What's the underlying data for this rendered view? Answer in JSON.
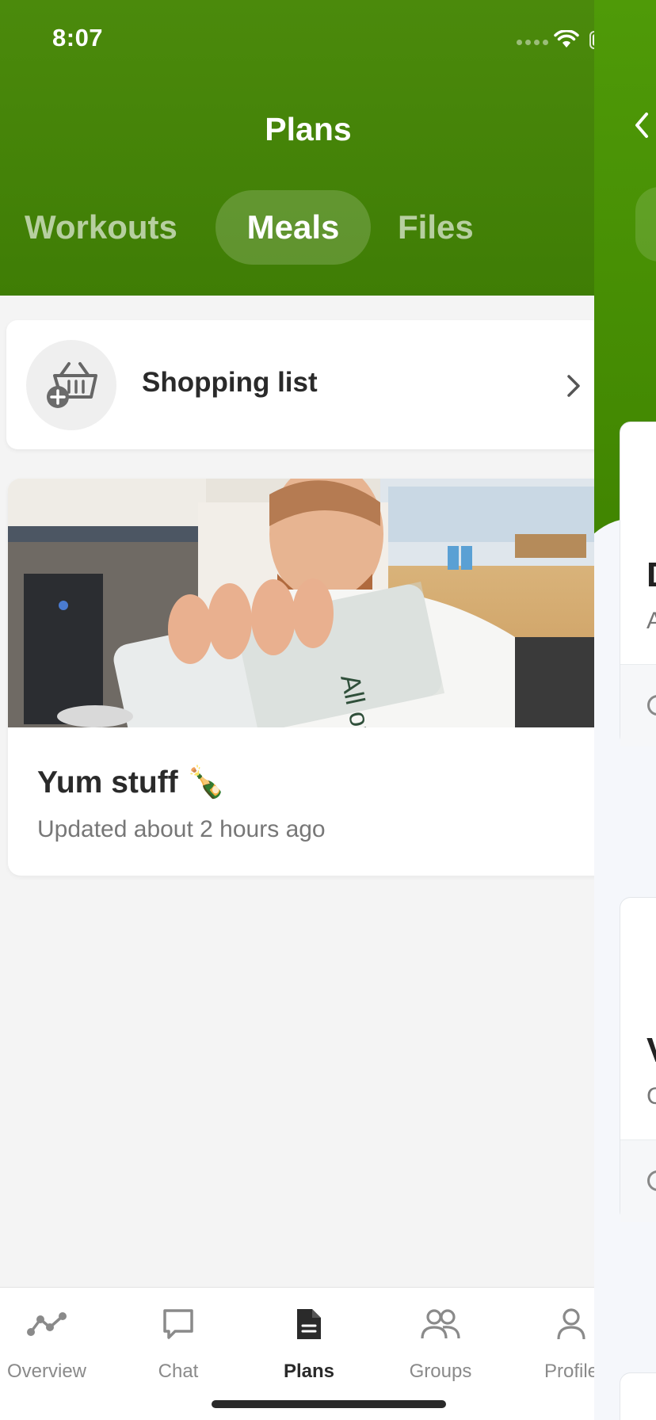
{
  "status_bar": {
    "time": "8:07"
  },
  "header": {
    "title": "Plans",
    "tabs": [
      {
        "label": "Workouts",
        "active": false
      },
      {
        "label": "Meals",
        "active": true
      },
      {
        "label": "Files",
        "active": false
      }
    ]
  },
  "shopping": {
    "label": "Shopping list",
    "icon": "basket-plus-icon"
  },
  "plans": [
    {
      "title": "Yum stuff 🍾",
      "updated": "Updated about 2 hours ago",
      "image": "person-holding-snack-bag-photo"
    }
  ],
  "tabbar": {
    "items": [
      {
        "label": "Overview",
        "icon": "overview-graph-icon",
        "active": false
      },
      {
        "label": "Chat",
        "icon": "chat-bubble-icon",
        "active": false
      },
      {
        "label": "Plans",
        "icon": "document-icon",
        "active": true
      },
      {
        "label": "Groups",
        "icon": "groups-icon",
        "active": false
      },
      {
        "label": "Profile",
        "icon": "profile-icon",
        "active": false
      }
    ]
  },
  "side_screen": {
    "cards": [
      {
        "letter": "D",
        "sub": "A"
      },
      {
        "letter": "V",
        "sub": "C"
      }
    ]
  },
  "colors": {
    "header_green": "#3f7d05",
    "side_green": "#4f9a08",
    "background": "#f4f4f4",
    "card": "#ffffff"
  }
}
